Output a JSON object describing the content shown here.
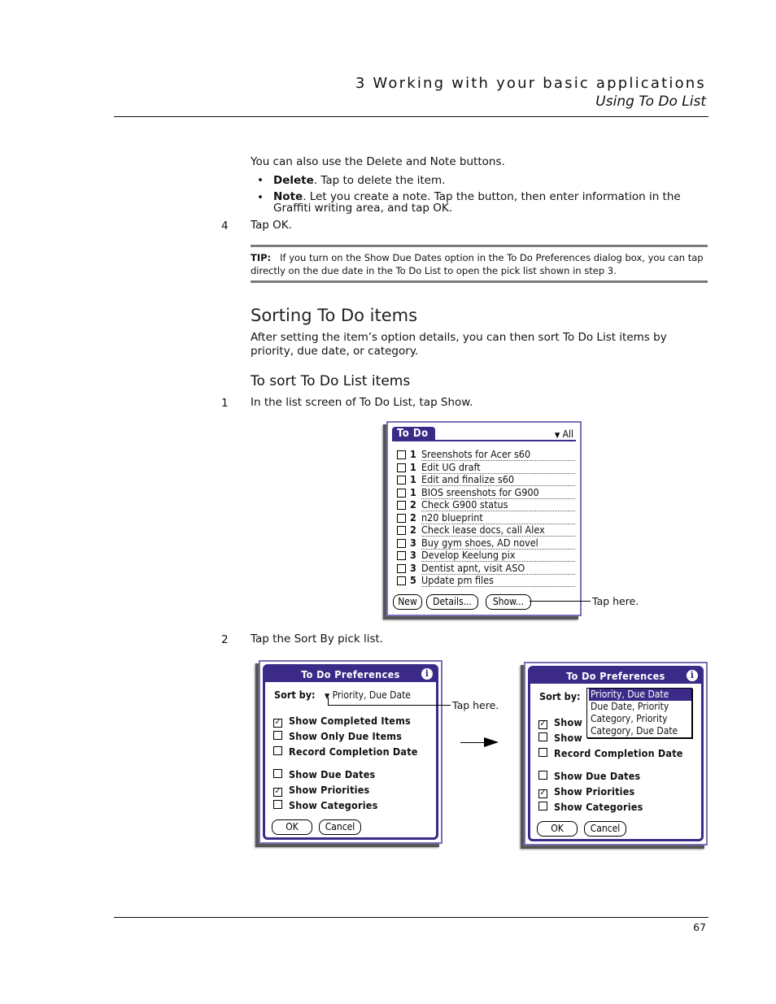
{
  "header": {
    "chapter": "3 Working with your basic applications",
    "section": "Using To Do List"
  },
  "intro": {
    "text": "You can also use the Delete and Note buttons.",
    "bullets": [
      {
        "term": "Delete",
        "text": ". Tap to delete the item."
      },
      {
        "term": "Note",
        "text": ". Let you create a note. Tap the button, then enter information in the Graffiti writing area, and tap OK."
      }
    ]
  },
  "step4": {
    "num": "4",
    "text": "Tap OK."
  },
  "tip": {
    "label": "TIP:",
    "text": "If you turn on the Show Due Dates option in the To Do Preferences dialog box, you can tap directly on the due date in the To Do List to open the pick list shown in step 3."
  },
  "section": {
    "title": "Sorting To Do items",
    "text": "After setting the item’s option details, you can then sort To Do List items by priority, due date, or category."
  },
  "procedure": {
    "title": "To sort To Do List items",
    "steps": [
      {
        "num": "1",
        "text": "In the list screen of To Do List, tap Show."
      },
      {
        "num": "2",
        "text": "Tap the Sort By pick list."
      }
    ]
  },
  "todo_screen": {
    "title": "To Do",
    "category": "All",
    "items": [
      {
        "priority": "1",
        "text": "Sreenshots for Acer s60",
        "done": false
      },
      {
        "priority": "1",
        "text": "Edit UG draft",
        "done": false
      },
      {
        "priority": "1",
        "text": "Edit and finalize s60",
        "done": false
      },
      {
        "priority": "1",
        "text": "BIOS sreenshots for G900",
        "done": false
      },
      {
        "priority": "2",
        "text": "Check G900 status",
        "done": false
      },
      {
        "priority": "2",
        "text": "n20 blueprint",
        "done": false
      },
      {
        "priority": "2",
        "text": "Check lease docs, call Alex",
        "done": false
      },
      {
        "priority": "3",
        "text": "Buy gym shoes, AD novel",
        "done": false
      },
      {
        "priority": "3",
        "text": "Develop Keelung pix",
        "done": false
      },
      {
        "priority": "3",
        "text": "Dentist apnt, visit ASO",
        "done": false
      },
      {
        "priority": "5",
        "text": "Update pm files",
        "done": false
      }
    ],
    "buttons": {
      "new": "New",
      "details": "Details...",
      "show": "Show..."
    },
    "callout": "Tap here."
  },
  "prefs_screen": {
    "title": "To Do Preferences",
    "info_icon": "i",
    "sort_label": "Sort by:",
    "sort_value": "Priority, Due Date",
    "options": [
      {
        "label": "Show Completed Items",
        "checked": true
      },
      {
        "label": "Show Only Due Items",
        "checked": false
      },
      {
        "label": "Record Completion Date",
        "checked": false
      },
      {
        "label": "Show Due Dates",
        "checked": false
      },
      {
        "label": "Show Priorities",
        "checked": true
      },
      {
        "label": "Show Categories",
        "checked": false
      }
    ],
    "ok": "OK",
    "cancel": "Cancel",
    "callout": "Tap here."
  },
  "prefs_screen_open": {
    "title": "To Do Preferences",
    "sort_label": "Sort by:",
    "sort_options": [
      "Priority, Due Date",
      "Due Date, Priority",
      "Category, Priority",
      "Category, Due Date"
    ],
    "selected_index": 0,
    "options": [
      {
        "label": "Show",
        "checked": true
      },
      {
        "label": "Show",
        "checked": false
      },
      {
        "label": "Record Completion Date",
        "checked": false
      },
      {
        "label": "Show Due Dates",
        "checked": false
      },
      {
        "label": "Show Priorities",
        "checked": true
      },
      {
        "label": "Show Categories",
        "checked": false
      }
    ],
    "ok": "OK",
    "cancel": "Cancel"
  },
  "colors": {
    "palm_accent": "#3b2a88",
    "palm_frame": "#7a6fb5"
  },
  "footer": {
    "page": "67"
  }
}
